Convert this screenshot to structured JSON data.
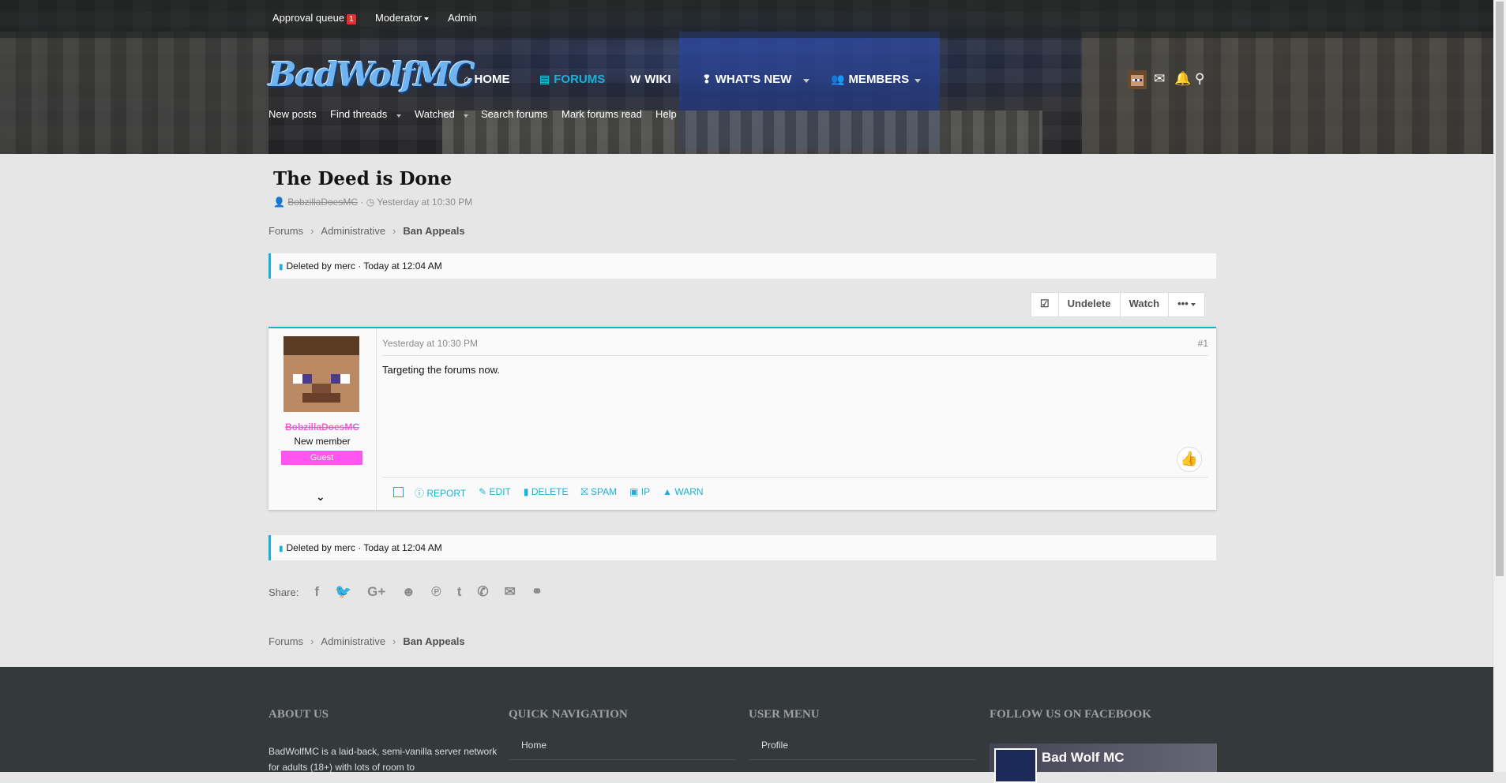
{
  "staff_bar": {
    "approval_queue": "Approval queue",
    "approval_count": "1",
    "moderator": "Moderator",
    "admin": "Admin"
  },
  "logo_text": "BadWolfMC",
  "nav": {
    "home": "HOME",
    "forums": "FORUMS",
    "wiki": "WIKI",
    "whats_new": "WHAT'S NEW",
    "members": "MEMBERS"
  },
  "subnav": {
    "new_posts": "New posts",
    "find_threads": "Find threads",
    "watched": "Watched",
    "search_forums": "Search forums",
    "mark_read": "Mark forums read",
    "help": "Help"
  },
  "thread": {
    "title": "The Deed is Done",
    "author": "BobzillaDoesMC",
    "date": "Yesterday at 10:30 PM"
  },
  "breadcrumb": [
    "Forums",
    "Administrative",
    "Ban Appeals"
  ],
  "deleted_notice": "Deleted by merc · Today at 12:04 AM",
  "thread_buttons": {
    "undelete": "Undelete",
    "watch": "Watch",
    "more": "•••"
  },
  "post": {
    "date": "Yesterday at 10:30 PM",
    "number": "#1",
    "body": "Targeting the forums now.",
    "username": "BobzillaDoesMC",
    "user_title": "New member",
    "banner": "Guest",
    "actions": {
      "report": "REPORT",
      "edit": "EDIT",
      "delete": "DELETE",
      "spam": "SPAM",
      "ip": "IP",
      "warn": "WARN"
    }
  },
  "share_label": "Share:",
  "footer": {
    "about_heading": "ABOUT US",
    "about_text": "BadWolfMC is a laid-back, semi-vanilla server network for adults (18+) with lots of room to",
    "quicknav_heading": "QUICK NAVIGATION",
    "quicknav_home": "Home",
    "usermenu_heading": "USER MENU",
    "usermenu_profile": "Profile",
    "facebook_heading": "FOLLOW US ON FACEBOOK",
    "facebook_page": "Bad Wolf MC"
  },
  "colors": {
    "accent": "#18b1d8",
    "username": "#ff55dd",
    "banner": "#ff55ee",
    "footer_bg": "#343a3b"
  }
}
